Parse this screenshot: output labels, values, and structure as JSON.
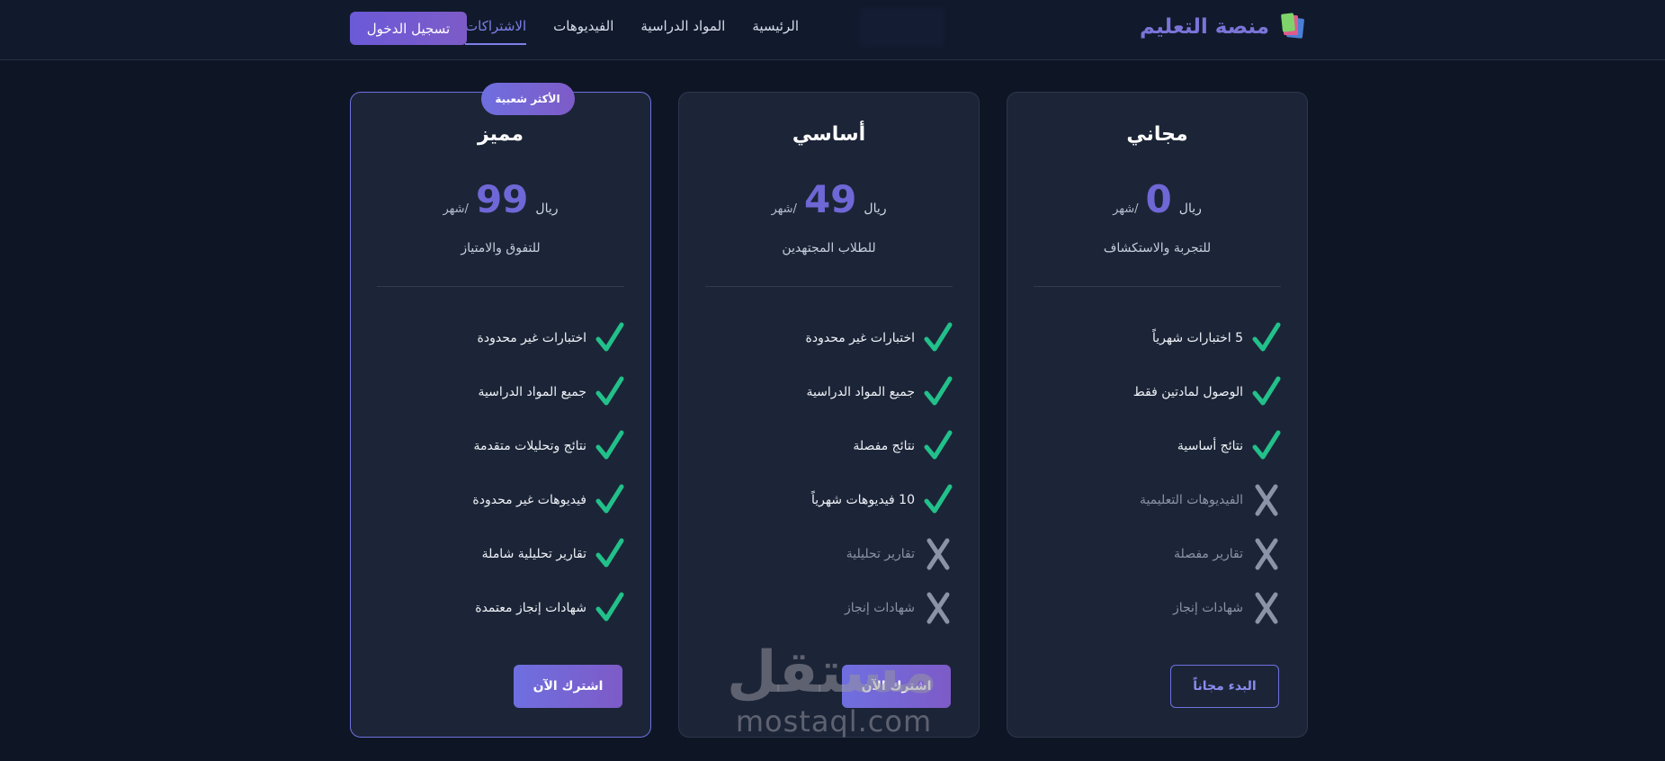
{
  "header": {
    "brand": "منصة التعليم",
    "nav": [
      {
        "label": "الرئيسية",
        "active": false
      },
      {
        "label": "المواد الدراسية",
        "active": false
      },
      {
        "label": "الفيديوهات",
        "active": false
      },
      {
        "label": "الاشتراكات",
        "active": true
      }
    ],
    "login_label": "تسجيل الدخول"
  },
  "plans": [
    {
      "name": "مجاني",
      "currency": "ريال",
      "price": "0",
      "period": "/شهر",
      "description": "للتجربة والاستكشاف",
      "features": [
        {
          "text": "5 اختبارات شهرياً",
          "included": true
        },
        {
          "text": "الوصول لمادتين فقط",
          "included": true
        },
        {
          "text": "نتائج أساسية",
          "included": true
        },
        {
          "text": "الفيديوهات التعليمية",
          "included": false
        },
        {
          "text": "تقارير مفصلة",
          "included": false
        },
        {
          "text": "شهادات إنجاز",
          "included": false
        }
      ],
      "cta": "البدء مجاناً"
    },
    {
      "name": "أساسي",
      "currency": "ريال",
      "price": "49",
      "period": "/شهر",
      "description": "للطلاب المجتهدين",
      "features": [
        {
          "text": "اختبارات غير محدودة",
          "included": true
        },
        {
          "text": "جميع المواد الدراسية",
          "included": true
        },
        {
          "text": "نتائج مفصلة",
          "included": true
        },
        {
          "text": "10 فيديوهات شهرياً",
          "included": true
        },
        {
          "text": "تقارير تحليلية",
          "included": false
        },
        {
          "text": "شهادات إنجاز",
          "included": false
        }
      ],
      "cta": "اشترك الآن"
    },
    {
      "name": "مميز",
      "badge": "الأكثر شعبية",
      "currency": "ريال",
      "price": "99",
      "period": "/شهر",
      "description": "للتفوق والامتياز",
      "features": [
        {
          "text": "اختبارات غير محدودة",
          "included": true
        },
        {
          "text": "جميع المواد الدراسية",
          "included": true
        },
        {
          "text": "نتائج وتحليلات متقدمة",
          "included": true
        },
        {
          "text": "فيديوهات غير محدودة",
          "included": true
        },
        {
          "text": "تقارير تحليلية شاملة",
          "included": true
        },
        {
          "text": "شهادات إنجاز معتمدة",
          "included": true
        }
      ],
      "cta": "اشترك الآن"
    }
  ],
  "watermark": {
    "arabic": "مستقل",
    "latin": "mostaql.com"
  },
  "colors": {
    "accent": "#6f6fe0",
    "check": "#22c08a",
    "cross": "#8a93a7",
    "background": "#0e1525",
    "card": "#1c2537"
  }
}
